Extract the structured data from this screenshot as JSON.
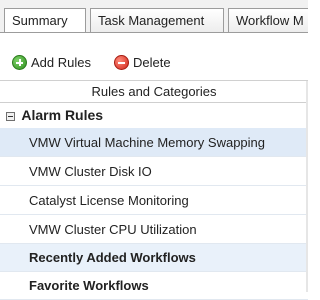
{
  "tabs": [
    {
      "label": "Summary"
    },
    {
      "label": "Task Management"
    },
    {
      "label": "Workflow M"
    }
  ],
  "toolbar": {
    "add_label": "Add Rules",
    "delete_label": "Delete"
  },
  "tree": {
    "column_header": "Rules and Categories",
    "group": {
      "label": "Alarm Rules",
      "items": [
        {
          "label": "VMW Virtual Machine Memory Swapping",
          "selected": true
        },
        {
          "label": "VMW Cluster Disk IO",
          "selected": false
        },
        {
          "label": "Catalyst License Monitoring",
          "selected": false
        },
        {
          "label": "VMW Cluster CPU Utilization",
          "selected": false
        }
      ]
    },
    "sections": [
      {
        "label": "Recently Added Workflows"
      },
      {
        "label": "Favorite Workflows"
      }
    ]
  },
  "colors": {
    "selected_row": "#dfeaf7",
    "section_highlight": "#e9f1fa",
    "add_icon": "#2e8f1e",
    "delete_icon": "#d0261a"
  },
  "icons": {
    "add": "add-circle-icon",
    "delete": "delete-circle-icon",
    "collapse": "collapse-minus-icon"
  }
}
